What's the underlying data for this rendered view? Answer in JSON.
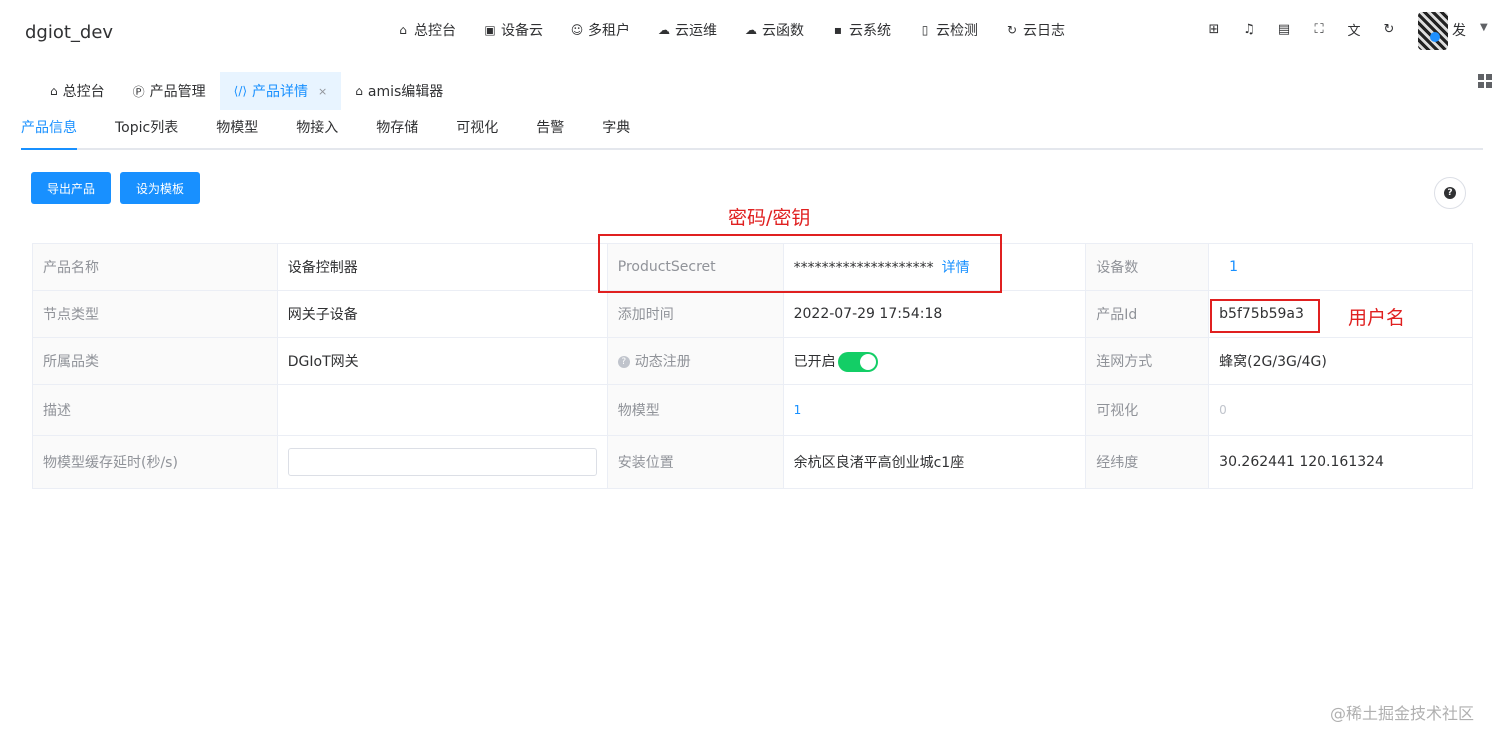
{
  "app": {
    "title": "dgiot_dev"
  },
  "nav": [
    {
      "icon": "home-icon",
      "label": "总控台"
    },
    {
      "icon": "device-cloud-icon",
      "label": "设备云"
    },
    {
      "icon": "tenants-icon",
      "label": "多租户"
    },
    {
      "icon": "ops-cloud-icon",
      "label": "云运维"
    },
    {
      "icon": "function-cloud-icon",
      "label": "云函数"
    },
    {
      "icon": "system-cloud-icon",
      "label": "云系统"
    },
    {
      "icon": "test-tube-icon",
      "label": "云检测"
    },
    {
      "icon": "log-icon",
      "label": "云日志"
    }
  ],
  "user": {
    "name": "发"
  },
  "visited_tabs": [
    {
      "icon": "home-icon",
      "label": "总控台"
    },
    {
      "icon": "product-icon",
      "label": "产品管理"
    },
    {
      "icon": "code-icon",
      "label": "产品详情",
      "close": "×"
    },
    {
      "icon": "home-icon",
      "label": "amis编辑器"
    }
  ],
  "detail_tabs": [
    "产品信息",
    "Topic列表",
    "物模型",
    "物接入",
    "物存储",
    "可视化",
    "告警",
    "字典"
  ],
  "buttons": {
    "export": "导出产品",
    "set_template": "设为模板"
  },
  "info": {
    "product_name_label": "产品名称",
    "product_name": "设备控制器",
    "secret_label": "ProductSecret",
    "secret": "********************",
    "secret_link": "详情",
    "device_count_label": "设备数",
    "device_count": "1",
    "node_type_label": "节点类型",
    "node_type": "网关子设备",
    "added_time_label": "添加时间",
    "added_time": "2022-07-29 17:54:18",
    "product_id_label": "产品Id",
    "product_id": "b5f75b59a3",
    "category_label": "所属品类",
    "category": "DGIoT网关",
    "dynamic_reg_label": "动态注册",
    "dynamic_reg": "已开启",
    "network_label": "连网方式",
    "network": "蜂窝(2G/3G/4G)",
    "desc_label": "描述",
    "desc": "",
    "thing_model_label": "物模型",
    "thing_model": "1",
    "visual_label": "可视化",
    "visual": "0",
    "cache_label": "物模型缓存延时(秒/s)",
    "cache_value": "",
    "location_label": "安装位置",
    "location": "余杭区良渚平高创业城c1座",
    "latlng_label": "经纬度",
    "latlng": "30.262441 120.161324"
  },
  "annotations": {
    "secret_note": "密码/密钥",
    "id_note": "用户名",
    "color": "#e02020"
  },
  "watermark": "@稀土掘金技术社区",
  "colors": {
    "primary": "#1890ff",
    "success": "#13ce66"
  }
}
